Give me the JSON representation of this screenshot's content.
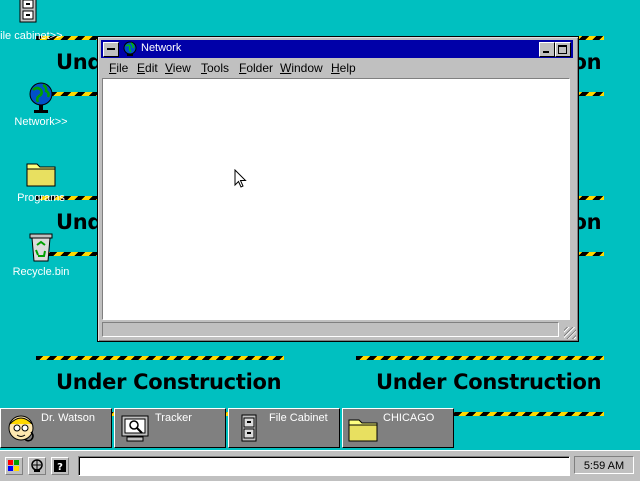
{
  "wallpaper": {
    "text": "Under Construction",
    "stripe_colors": [
      "#000000",
      "#ffd800"
    ],
    "background": "#00c0c0"
  },
  "desktop_icons": [
    {
      "label": "File cabinet>>",
      "icon": "file-cabinet-icon"
    },
    {
      "label": "Network>>",
      "icon": "network-globe-icon"
    },
    {
      "label": "Programs",
      "icon": "folder-icon"
    },
    {
      "label": "Recycle.bin",
      "icon": "recycle-bin-icon"
    }
  ],
  "window": {
    "title": "Network",
    "title_color": "#0000a8",
    "menu": [
      {
        "label": "File",
        "accel": "F",
        "rest": "ile"
      },
      {
        "label": "Edit",
        "accel": "E",
        "rest": "dit"
      },
      {
        "label": "View",
        "accel": "V",
        "rest": "iew"
      },
      {
        "label": "Tools",
        "accel": "T",
        "rest": "ools"
      },
      {
        "label": "Folder",
        "accel": "F",
        "rest": "older"
      },
      {
        "label": "Window",
        "accel": "W",
        "rest": "indow"
      },
      {
        "label": "Help",
        "accel": "H",
        "rest": "elp"
      }
    ]
  },
  "minimized_windows": [
    {
      "label": "Dr. Watson",
      "icon": "dr-watson-icon"
    },
    {
      "label": "Tracker",
      "icon": "tracker-monitor-icon"
    },
    {
      "label": "File Cabinet",
      "icon": "file-cabinet-icon"
    },
    {
      "label": "CHICAGO",
      "icon": "folder-icon"
    }
  ],
  "taskbar": {
    "clock": "5:59 AM",
    "buttons": [
      "start-windows-icon",
      "network-icon",
      "help-icon"
    ]
  }
}
